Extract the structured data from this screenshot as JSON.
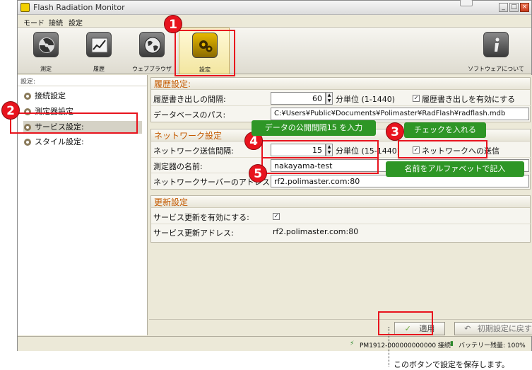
{
  "window": {
    "title": "Flash Radiation Monitor",
    "minimize": "_",
    "maximize": "□",
    "close": "×"
  },
  "menu": [
    "モード",
    "接続",
    "設定"
  ],
  "toolbar": [
    {
      "label": "測定",
      "icon": "radiation-icon"
    },
    {
      "label": "履歴",
      "icon": "history-chart-icon"
    },
    {
      "label": "ウェブブラウザ",
      "icon": "globe-icon"
    },
    {
      "label": "設定",
      "icon": "gears-icon"
    },
    {
      "label": "ソフトウェアについて",
      "icon": "info-icon"
    }
  ],
  "sidebar": {
    "header": "設定:",
    "items": [
      {
        "label": "接続設定"
      },
      {
        "label": "測定器設定"
      },
      {
        "label": "サービス設定:"
      },
      {
        "label": "スタイル設定:"
      }
    ]
  },
  "history": {
    "title": "履歴設定:",
    "write_interval_label": "履歴書き出しの間隔:",
    "write_interval_value": "60",
    "write_interval_unit": "分単位 (1-1440)",
    "write_enable_label": "履歴書き出しを有効にする",
    "db_path_label": "データベースのパス:",
    "db_path_value": "C:¥Users¥Public¥Documents¥Polimaster¥RadFlash¥radflash.mdb"
  },
  "network": {
    "title": "ネットワーク設定",
    "interval_label": "ネットワーク送信間隔:",
    "interval_value": "15",
    "interval_unit": "分単位 (15-1440)",
    "send_label": "ネットワークへの送信",
    "device_name_label": "測定器の名前:",
    "device_name_value": "nakayama-test",
    "server_label": "ネットワークサーバーのアドレス:",
    "server_value": "rf2.polimaster.com:80"
  },
  "update": {
    "title": "更新設定",
    "enable_label": "サービス更新を有効にする:",
    "address_label": "サービス更新アドレス:",
    "address_value": "rf2.polimaster.com:80"
  },
  "buttons": {
    "apply": "適用",
    "reset": "初期設定に戻す"
  },
  "status": {
    "device": "PM1912-000000000000 接続",
    "battery": "バッテリー残量: 100%"
  },
  "annotations": {
    "badges": [
      "1",
      "2",
      "3",
      "4",
      "5"
    ],
    "tip_interval": "データの公開間隔15 を入力",
    "tip_check": "チェックを入れる",
    "tip_name": "名前をアルファベットで記入",
    "save_note": "このボタンで設定を保存します。"
  }
}
